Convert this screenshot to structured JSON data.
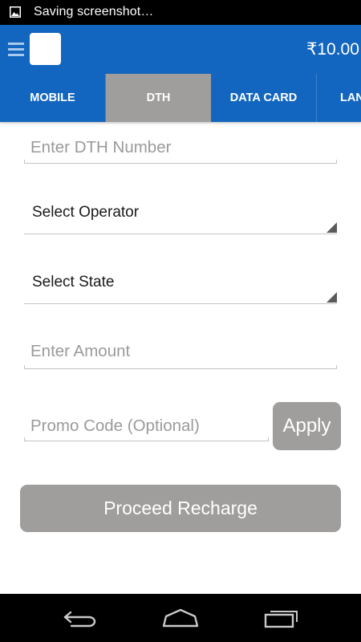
{
  "status_bar": {
    "notification_text": "Saving screenshot…",
    "notification_icon": "image-icon"
  },
  "app_bar": {
    "menu_icon": "hamburger-menu-icon",
    "balance": "₹10.00"
  },
  "tabs": [
    {
      "label": "MOBILE",
      "active": false
    },
    {
      "label": "DTH",
      "active": true
    },
    {
      "label": "DATA CARD",
      "active": false
    },
    {
      "label": "LANDLINE",
      "active": false
    }
  ],
  "form": {
    "dth_number_placeholder": "Enter DTH Number",
    "operator_select": "Select Operator",
    "state_select": "Select State",
    "amount_placeholder": "Enter Amount",
    "promo_placeholder": "Promo Code (Optional)",
    "apply_label": "Apply",
    "proceed_label": "Proceed Recharge"
  },
  "nav_bar": {
    "back_icon": "back-icon",
    "home_icon": "home-icon",
    "recents_icon": "recent-apps-icon"
  },
  "colors": {
    "primary": "#1366bf",
    "active_tab": "#a09e9d",
    "button": "#a09e9d"
  }
}
